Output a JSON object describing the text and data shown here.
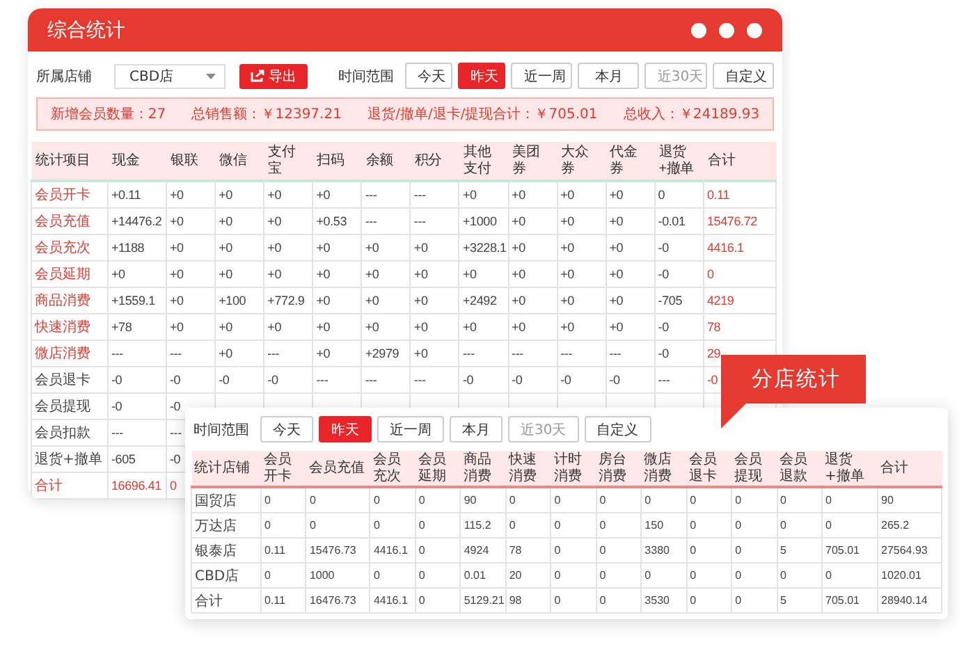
{
  "main": {
    "title": "综合统计",
    "store_label": "所属店铺",
    "store_select": "CBD店",
    "export_button": "导出",
    "time_label": "时间范围",
    "time_buttons": [
      {
        "label": "今天",
        "selected": false,
        "disabled": false
      },
      {
        "label": "昨天",
        "selected": true,
        "disabled": false
      },
      {
        "label": "近一周",
        "selected": false,
        "disabled": false
      },
      {
        "label": "本月",
        "selected": false,
        "disabled": false
      },
      {
        "label": "近30天",
        "selected": false,
        "disabled": true
      },
      {
        "label": "自定义",
        "selected": false,
        "disabled": false
      }
    ],
    "summary": [
      "新增会员数量：27",
      "总销售额：￥12397.21",
      "退货/撤单/退卡/提现合计：￥705.01",
      "总收入：￥24189.93"
    ],
    "table": {
      "columns": [
        "统计项目",
        "现金",
        "银联",
        "微信",
        "支付宝",
        "扫码",
        "余额",
        "积分",
        "其他支付",
        "美团券",
        "大众券",
        "代金券",
        "退货+撤单",
        "合计"
      ],
      "rows": [
        {
          "kind": "income",
          "cells": [
            "会员开卡",
            "+0.11",
            "+0",
            "+0",
            "+0",
            "+0",
            "---",
            "---",
            "+0",
            "+0",
            "+0",
            "+0",
            "0",
            "0.11"
          ]
        },
        {
          "kind": "income",
          "cells": [
            "会员充值",
            "+14476.2",
            "+0",
            "+0",
            "+0",
            "+0.53",
            "---",
            "---",
            "+1000",
            "+0",
            "+0",
            "+0",
            "-0.01",
            "15476.72"
          ]
        },
        {
          "kind": "income",
          "cells": [
            "会员充次",
            "+1188",
            "+0",
            "+0",
            "+0",
            "+0",
            "+0",
            "+0",
            "+3228.1",
            "+0",
            "+0",
            "+0",
            "-0",
            "4416.1"
          ]
        },
        {
          "kind": "income",
          "cells": [
            "会员延期",
            "+0",
            "+0",
            "+0",
            "+0",
            "+0",
            "+0",
            "+0",
            "+0",
            "+0",
            "+0",
            "+0",
            "-0",
            "0"
          ]
        },
        {
          "kind": "income",
          "cells": [
            "商品消费",
            "+1559.1",
            "+0",
            "+100",
            "+772.9",
            "+0",
            "+0",
            "+0",
            "+2492",
            "+0",
            "+0",
            "+0",
            "-705",
            "4219"
          ]
        },
        {
          "kind": "income",
          "cells": [
            "快速消费",
            "+78",
            "+0",
            "+0",
            "+0",
            "+0",
            "+0",
            "+0",
            "+0",
            "+0",
            "+0",
            "+0",
            "-0",
            "78"
          ]
        },
        {
          "kind": "income",
          "cells": [
            "微店消费",
            "---",
            "---",
            "+0",
            "---",
            "+0",
            "+2979",
            "+0",
            "---",
            "---",
            "---",
            "---",
            "-0",
            "29"
          ]
        },
        {
          "kind": "deduct",
          "cells": [
            "会员退卡",
            "-0",
            "-0",
            "-0",
            "-0",
            "---",
            "---",
            "---",
            "-0",
            "-0",
            "-0",
            "-0",
            "---",
            "-0"
          ]
        },
        {
          "kind": "deduct",
          "cells": [
            "会员提现",
            "-0",
            "-0"
          ]
        },
        {
          "kind": "deduct",
          "cells": [
            "会员扣款",
            "---",
            "---"
          ]
        },
        {
          "kind": "deduct",
          "cells": [
            "退货+撤单",
            "-605",
            "-0"
          ]
        },
        {
          "kind": "total",
          "cells": [
            "合计",
            "16696.41",
            "0"
          ]
        }
      ]
    }
  },
  "branch": {
    "tag": "分店统计",
    "time_label": "时间范围",
    "time_buttons": [
      {
        "label": "今天",
        "selected": false,
        "disabled": false
      },
      {
        "label": "昨天",
        "selected": true,
        "disabled": false
      },
      {
        "label": "近一周",
        "selected": false,
        "disabled": false
      },
      {
        "label": "本月",
        "selected": false,
        "disabled": false
      },
      {
        "label": "近30天",
        "selected": false,
        "disabled": true
      },
      {
        "label": "自定义",
        "selected": false,
        "disabled": false
      }
    ],
    "table": {
      "columns": [
        "统计店铺",
        "会员开卡",
        "会员充值",
        "会员充次",
        "会员延期",
        "商品消费",
        "快速消费",
        "计时消费",
        "房台消费",
        "微店消费",
        "会员退卡",
        "会员提现",
        "会员退款",
        "退货+撤单",
        "合计"
      ],
      "rows": [
        [
          "国贸店",
          "0",
          "0",
          "0",
          "0",
          "90",
          "0",
          "0",
          "0",
          "0",
          "0",
          "0",
          "0",
          "0",
          "90"
        ],
        [
          "万达店",
          "0",
          "0",
          "0",
          "0",
          "115.2",
          "0",
          "0",
          "0",
          "150",
          "0",
          "0",
          "0",
          "0",
          "265.2"
        ],
        [
          "银泰店",
          "0.11",
          "15476.73",
          "4416.1",
          "0",
          "4924",
          "78",
          "0",
          "0",
          "3380",
          "0",
          "0",
          "5",
          "705.01",
          "27564.93"
        ],
        [
          "CBD店",
          "0",
          "1000",
          "0",
          "0",
          "0.01",
          "20",
          "0",
          "0",
          "0",
          "0",
          "0",
          "0",
          "0",
          "1020.01"
        ],
        [
          "合计",
          "0.11",
          "16476.73",
          "4416.1",
          "0",
          "5129.21",
          "98",
          "0",
          "0",
          "3530",
          "0",
          "0",
          "5",
          "705.01",
          "28940.14"
        ]
      ]
    }
  }
}
